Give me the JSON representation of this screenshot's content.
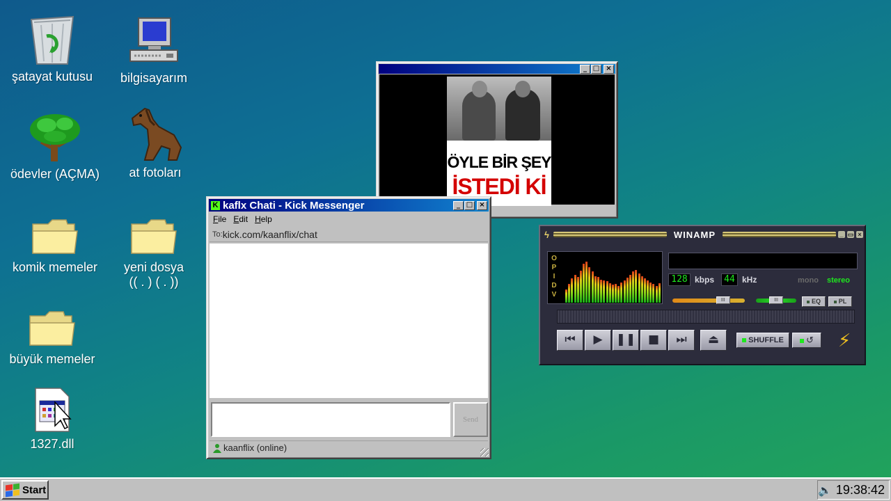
{
  "desktop": {
    "icons": [
      {
        "label": "şatayat kutusu",
        "icon": "recycle-bin-icon"
      },
      {
        "label": "bilgisayarım",
        "icon": "my-computer-icon"
      },
      {
        "label": "ödevler (AÇMA)",
        "icon": "tree-icon"
      },
      {
        "label": "at fotoları",
        "icon": "horse-icon"
      },
      {
        "label": "komik memeler",
        "icon": "folder-icon"
      },
      {
        "label": "yeni dosya",
        "label2": "(( . ) ( . ))",
        "icon": "folder-icon"
      },
      {
        "label": "büyük memeler",
        "icon": "folder-icon"
      },
      {
        "label": "1327.dll",
        "icon": "dll-file-icon"
      }
    ]
  },
  "viewer": {
    "title": "",
    "caption_line1": "ÖYLE BİR ŞEY",
    "caption_line2": "İSTEDİ Kİ"
  },
  "messenger": {
    "title": "kaflx Chati - Kick Messenger",
    "menu": [
      "File",
      "Edit",
      "Help"
    ],
    "to_label": "To:",
    "url": "kick.com/kaanflix/chat",
    "input_value": "",
    "send_label": "Send",
    "status": "kaanflix (online)"
  },
  "winamp": {
    "title": "WINAMP",
    "side_letters": [
      "O",
      "P",
      "I",
      "D",
      "V"
    ],
    "track": "",
    "kbps": "128",
    "kbps_label": "kbps",
    "khz": "44",
    "khz_label": "kHz",
    "mono": "mono",
    "stereo": "stereo",
    "eq_label": "EQ",
    "pl_label": "PL",
    "shuffle_label": "SHUFFLE",
    "volume": 0.7,
    "balance": 0.5,
    "spectrum": [
      30,
      42,
      55,
      62,
      58,
      72,
      88,
      92,
      80,
      70,
      60,
      58,
      52,
      50,
      48,
      44,
      40,
      42,
      38,
      46,
      50,
      56,
      62,
      70,
      74,
      66,
      60,
      54,
      50,
      46,
      42,
      38,
      44
    ]
  },
  "taskbar": {
    "start_label": "Start",
    "clock": "19:38:42"
  },
  "colors": {
    "titlebar_active": "#000080",
    "desktop_top": "#0f5a8c",
    "desktop_bottom": "#22a45a",
    "meme_red": "#d40000"
  }
}
